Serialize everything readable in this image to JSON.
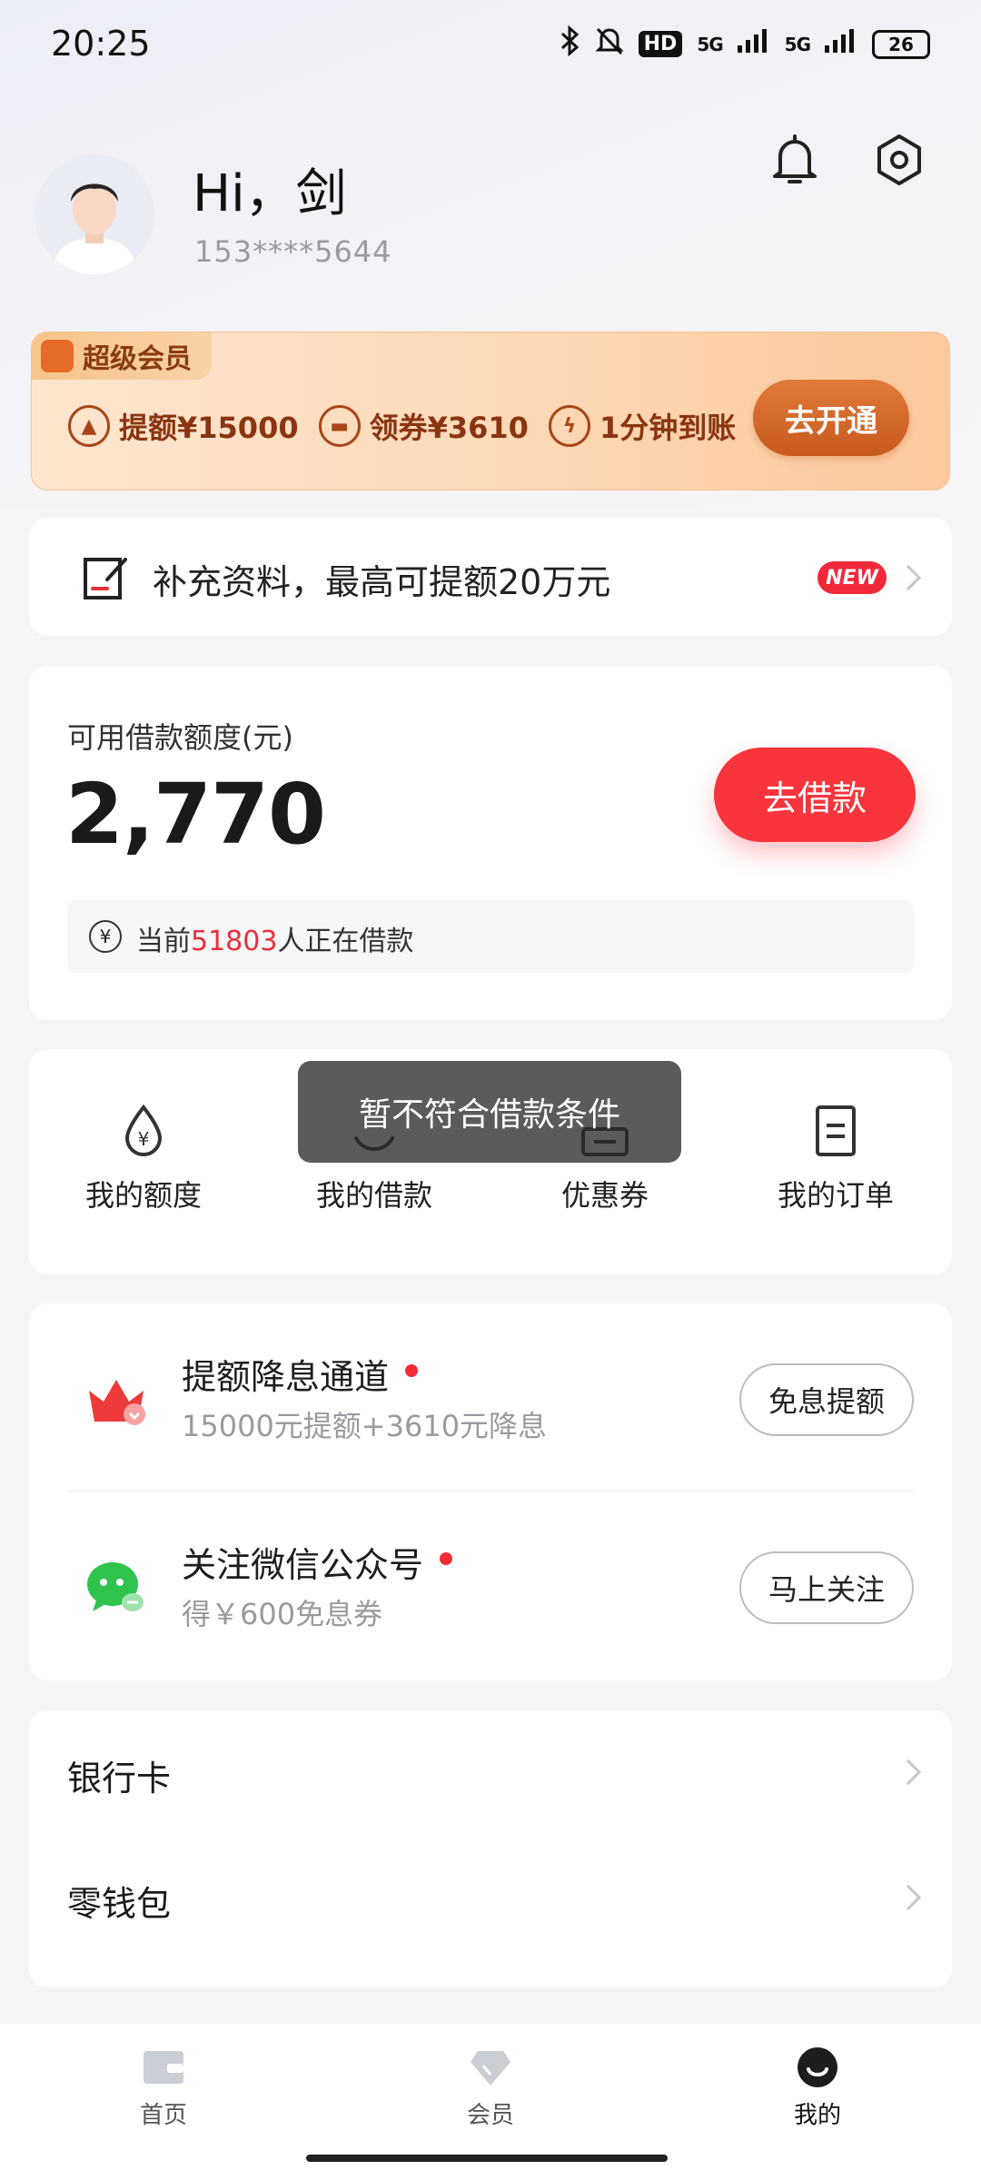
{
  "status_bar": {
    "time": "20:25",
    "hd_label": "HD",
    "signal_1": "5G",
    "signal_2": "5G",
    "battery": "26",
    "icons": [
      "bluetooth-icon",
      "mute-icon",
      "signal-icon",
      "battery-icon"
    ]
  },
  "header": {
    "greeting": "Hi，剑",
    "phone": "153****5644",
    "icons": [
      "bell-icon",
      "settings-icon"
    ]
  },
  "vip": {
    "tag": "超级会员",
    "benefits": [
      {
        "icon": "arrow-up-icon",
        "label": "提额¥15000"
      },
      {
        "icon": "ticket-icon",
        "label": "领券¥3610"
      },
      {
        "icon": "lightning-icon",
        "label": "1分钟到账"
      }
    ],
    "button": "去开通"
  },
  "supplement": {
    "text": "补充资料，最高可提额20万元",
    "badge": "NEW"
  },
  "loan": {
    "label": "可用借款额度(元)",
    "amount": "2,770",
    "button": "去借款",
    "notice_prefix": "当前",
    "notice_count": "51803",
    "notice_suffix": "人正在借款"
  },
  "quick_menu": {
    "items": [
      {
        "label": "我的额度",
        "icon": "drop-yen-icon"
      },
      {
        "label": "我的借款",
        "icon": "loan-icon"
      },
      {
        "label": "优惠券",
        "icon": "coupon-icon"
      },
      {
        "label": "我的订单",
        "icon": "order-icon"
      }
    ]
  },
  "toast": "暂不符合借款条件",
  "promos": [
    {
      "title": "提额降息通道",
      "subtitle": "15000元提额+3610元降息",
      "button": "免息提额",
      "icon": "crown-icon"
    },
    {
      "title": "关注微信公众号",
      "subtitle": "得￥600免息券",
      "button": "马上关注",
      "icon": "wechat-icon"
    }
  ],
  "list": [
    {
      "label": "银行卡"
    },
    {
      "label": "零钱包"
    }
  ],
  "tab_bar": {
    "tabs": [
      {
        "label": "首页",
        "icon": "wallet-icon"
      },
      {
        "label": "会员",
        "icon": "diamond-icon"
      },
      {
        "label": "我的",
        "icon": "profile-icon"
      }
    ],
    "active": "我的"
  },
  "colors": {
    "accent_red": "#f8343c",
    "vip_orange": "#c85a1f",
    "count_red": "#e8303a"
  }
}
